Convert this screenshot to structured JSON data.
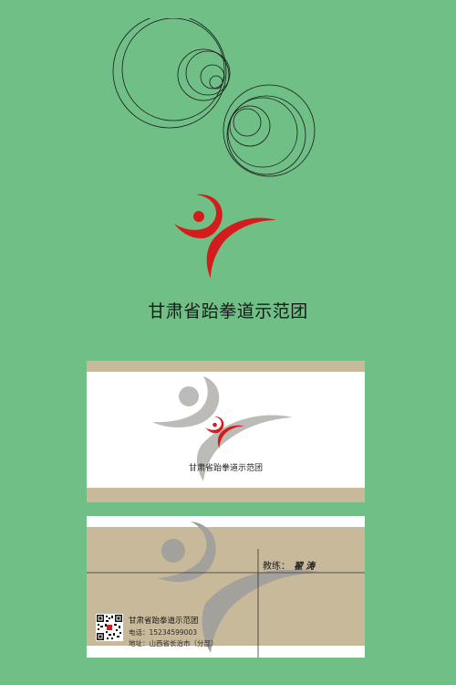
{
  "org": {
    "name": "甘肃省跆拳道示范团"
  },
  "colors": {
    "background": "#6fbf87",
    "logo_red": "#d41c1c",
    "card_beige": "#c8b99a",
    "watermark_gray": "#a3a19c"
  },
  "icons": {
    "logo": "taekwondo-figure-logo",
    "qr": "qr-code-icon"
  },
  "card_front": {
    "title": "甘肃省跆拳道示范团"
  },
  "card_back": {
    "coach_label": "教练：",
    "coach_name": "翟涛",
    "org_name": "甘肃省跆拳道示范团",
    "phone_label": "电话：",
    "phone": "15234599003",
    "address_label": "地址：",
    "address": "山西省长治市（分部）"
  }
}
